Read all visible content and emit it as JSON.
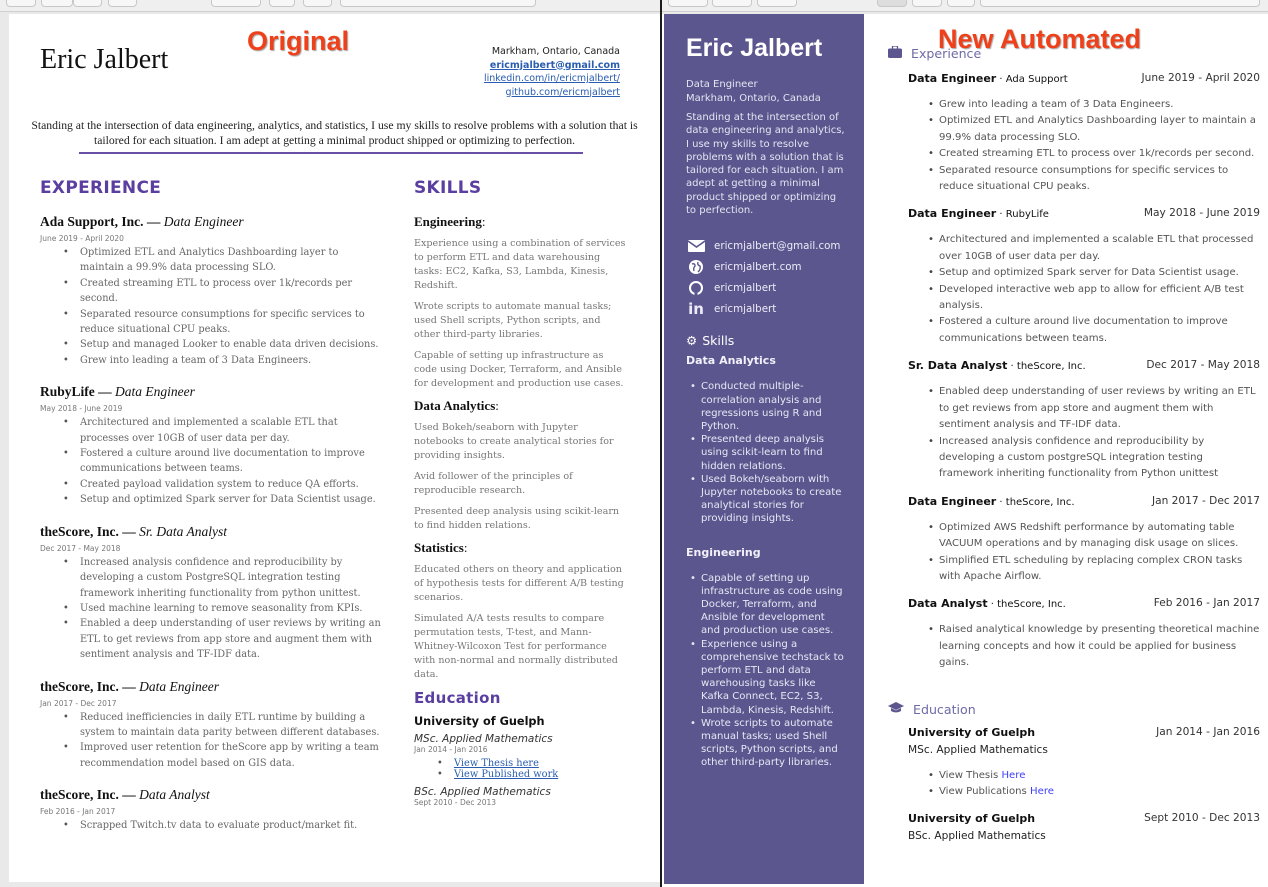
{
  "labels": {
    "original": "Original",
    "automated": "New Automated"
  },
  "original": {
    "name": "Eric Jalbert",
    "location": "Markham, Ontario, Canada",
    "email": "ericmjalbert@gmail.com",
    "linkedin": "linkedin.com/in/ericmjalbert/",
    "github": "github.com/ericmjalbert",
    "summary": "Standing at the intersection of data engineering, analytics, and statistics, I use my skills to resolve problems with a solution that is tailored for each situation. I am adept at getting a minimal product shipped or optimizing to perfection.",
    "experience_heading": "EXPERIENCE",
    "jobs": [
      {
        "company": "Ada Support, Inc.",
        "role": "Data Engineer",
        "dates": "June 2019 - April 2020",
        "bullets": [
          "Optimized ETL and Analytics Dashboarding layer to maintain a 99.9% data processing SLO.",
          "Created streaming ETL to process over 1k/records per second.",
          "Separated resource consumptions for specific services to reduce situational CPU peaks.",
          "Setup and managed Looker to enable data driven decisions.",
          "Grew into leading a team of 3 Data Engineers."
        ]
      },
      {
        "company": "RubyLife",
        "role": "Data Engineer",
        "dates": "May 2018 - June 2019",
        "bullets": [
          "Architectured and implemented a scalable ETL that processes over 10GB of user data per day.",
          "Fostered a culture around live documentation to improve communications between teams.",
          "Created payload validation system to reduce QA efforts.",
          "Setup and optimized Spark server for Data Scientist usage."
        ]
      },
      {
        "company": "theScore, Inc.",
        "role": "Sr. Data Analyst",
        "dates": "Dec 2017 - May 2018",
        "bullets": [
          "Increased analysis confidence and reproducibility by developing a custom PostgreSQL integration testing framework inheriting functionality from python unittest.",
          "Used machine learning to remove seasonality from KPIs.",
          "Enabled a deep understanding of user reviews by writing an ETL to get reviews from app store and augment them with sentiment analysis and TF-IDF data."
        ]
      },
      {
        "company": "theScore, Inc.",
        "role": "Data Engineer",
        "dates": "Jan 2017 - Dec 2017",
        "bullets": [
          "Reduced inefficiencies in daily ETL runtime by building a system to maintain data parity between different databases.",
          "Improved user retention for theScore app by writing a team recommendation model based on GIS data."
        ]
      },
      {
        "company": "theScore, Inc.",
        "role": "Data Analyst",
        "dates": "Feb 2016 - Jan 2017",
        "bullets": [
          "Scrapped Twitch.tv data to evaluate product/market fit."
        ]
      }
    ],
    "skills_heading": "SKILLS",
    "skills": [
      {
        "name": "Engineering",
        "items": [
          "Experience using a combination of services to perform ETL and data warehousing tasks: EC2, Kafka, S3, Lambda, Kinesis, Redshift.",
          "Wrote scripts to automate manual tasks; used Shell scripts, Python scripts, and other third-party libraries.",
          "Capable of setting up infrastructure as code using Docker, Terraform, and Ansible for development and production use cases."
        ]
      },
      {
        "name": "Data Analytics",
        "items": [
          "Used Bokeh/seaborn with Jupyter notebooks to create analytical stories for providing insights.",
          "Avid follower of the principles of reproducible research.",
          "Presented deep analysis using scikit-learn to find hidden relations."
        ]
      },
      {
        "name": "Statistics",
        "items": [
          "Educated others on theory and application of hypothesis tests for different A/B testing scenarios.",
          "Simulated A/A tests results to compare permutation tests, T-test, and Mann-Whitney-Wilcoxon Test for performance with non-normal and normally distributed data."
        ]
      }
    ],
    "education_heading": "Education",
    "education": {
      "school": "University of Guelph",
      "msc": "MSc. Applied Mathematics",
      "msc_dates": "Jan 2014 - Jan 2016",
      "links": [
        "View Thesis here",
        "View Published work"
      ],
      "bsc": "BSc. Applied Mathematics",
      "bsc_dates": "Sept 2010 - Dec 2013"
    }
  },
  "automated": {
    "name": "Eric Jalbert",
    "title": "Data Engineer",
    "location": "Markham, Ontario, Canada",
    "bio": "Standing at the intersection of data engineering and analytics, I use my skills to resolve problems with a solution that is tailored for each situation. I am adept at getting a minimal product shipped or optimizing to perfection.",
    "contacts": [
      {
        "icon": "envelope-icon",
        "text": "ericmjalbert@gmail.com"
      },
      {
        "icon": "globe-icon",
        "text": "ericmjalbert.com"
      },
      {
        "icon": "github-icon",
        "text": "ericmjalbert"
      },
      {
        "icon": "linkedin-icon",
        "text": "ericmjalbert"
      }
    ],
    "skills_title": "Skills",
    "skills": [
      {
        "name": "Data Analytics",
        "items": [
          "Conducted multiple-correlation analysis and regressions using R and Python.",
          "Presented deep analysis using scikit-learn to find hidden relations.",
          "Used Bokeh/seaborn with Jupyter notebooks to create analytical stories for providing insights."
        ]
      },
      {
        "name": "Engineering",
        "items": [
          "Capable of setting up infrastructure as code using Docker, Terraform, and Ansible for development and production use cases.",
          "Experience using a comprehensive techstack to perform ETL and data warehousing tasks like Kafka Connect, EC2, S3, Lambda, Kinesis, Redshift.",
          "Wrote scripts to automate manual tasks; used Shell scripts, Python scripts, and other third-party libraries."
        ]
      }
    ],
    "experience_title": "Experience",
    "jobs": [
      {
        "role": "Data Engineer",
        "org": "Ada Support",
        "dates": "June 2019 - April 2020",
        "bullets": [
          "Grew into leading a team of 3 Data Engineers.",
          "Optimized ETL and Analytics Dashboarding layer to maintain a 99.9% data processing SLO.",
          "Created streaming ETL to process over 1k/records per second.",
          "Separated resource consumptions for specific services to reduce situational CPU peaks."
        ]
      },
      {
        "role": "Data Engineer",
        "org": "RubyLife",
        "dates": "May 2018 - June 2019",
        "bullets": [
          "Architectured and implemented a scalable ETL that processed over 10GB of user data per day.",
          "Setup and optimized Spark server for Data Scientist usage.",
          "Developed interactive web app to allow for efficient A/B test analysis.",
          "Fostered a culture around live documentation to improve communications between teams."
        ]
      },
      {
        "role": "Sr. Data Analyst",
        "org": "theScore, Inc.",
        "dates": "Dec 2017 - May 2018",
        "bullets": [
          "Enabled deep understanding of user reviews by writing an ETL to get reviews from app store and augment them with sentiment analysis and TF-IDF data.",
          "Increased analysis confidence and reproducibility by developing a custom postgreSQL integration testing framework inheriting functionality from Python unittest"
        ]
      },
      {
        "role": "Data Engineer",
        "org": "theScore, Inc.",
        "dates": "Jan 2017 - Dec 2017",
        "bullets": [
          "Optimized AWS Redshift performance by automating table VACUUM operations and by managing disk usage on slices.",
          "Simplified ETL scheduling by replacing complex CRON tasks with Apache Airflow."
        ]
      },
      {
        "role": "Data Analyst",
        "org": "theScore, Inc.",
        "dates": "Feb 2016 - Jan 2017",
        "bullets": [
          "Raised analytical knowledge by presenting theoretical machine learning concepts and how it could be applied for business gains."
        ]
      }
    ],
    "education_title": "Education",
    "education": [
      {
        "school": "University of Guelph",
        "degree": "MSc. Applied Mathematics",
        "dates": "Jan 2014 - Jan 2016",
        "links": [
          {
            "prefix": "View Thesis",
            "link": "Here"
          },
          {
            "prefix": "View Publications",
            "link": "Here"
          }
        ]
      },
      {
        "school": "University of Guelph",
        "degree": "BSc. Applied Mathematics",
        "dates": "Sept 2010 - Dec 2013",
        "links": []
      }
    ],
    "accent_color": "#5b578e"
  }
}
